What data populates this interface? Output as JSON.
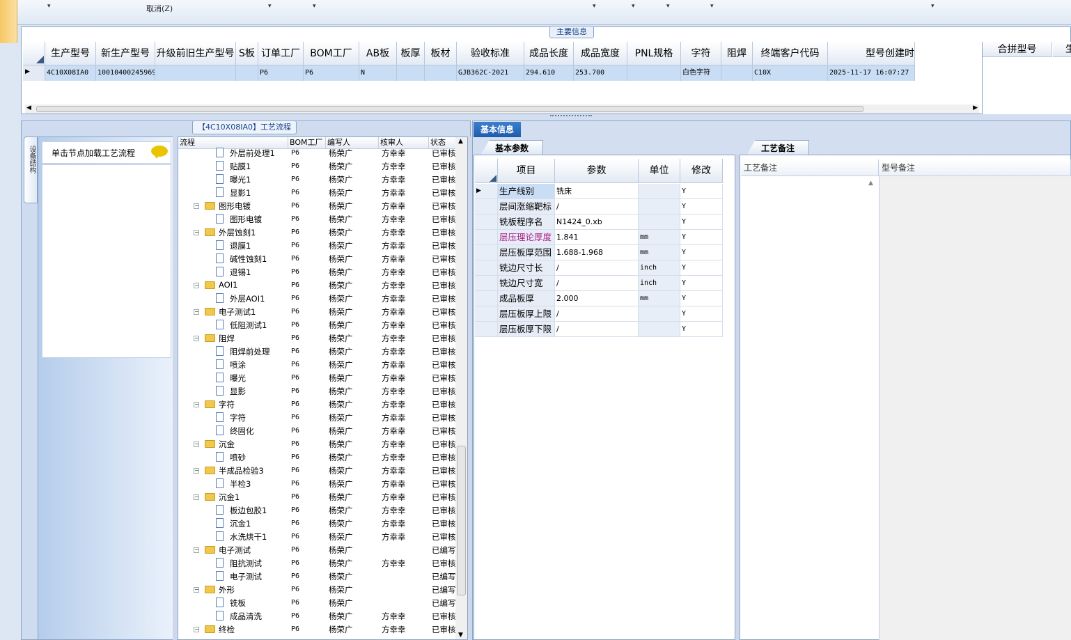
{
  "toolbar": {
    "cancel_label": "取消(Z)"
  },
  "main_info": {
    "caption": "主要信息",
    "columns": [
      "生产型号",
      "新生产型号",
      "升级前旧生产型号",
      "S板",
      "订单工厂",
      "BOM工厂",
      "AB板",
      "板厚",
      "板材",
      "验收标准",
      "成品长度",
      "成品宽度",
      "PNL规格",
      "字符",
      "阻焊",
      "终端客户代码",
      "型号创建时"
    ],
    "row": [
      "4C10X08IA0",
      "10010400245969",
      "",
      "",
      "P6",
      "P6",
      "N",
      "",
      "",
      "GJB362C-2021",
      "294.610",
      "253.700",
      "",
      "白色字符",
      "",
      "C10X",
      "2025-11-17 16:07:27"
    ],
    "side_columns": [
      "合拼型号",
      "生"
    ]
  },
  "process": {
    "caption": "【4C10X08IA0】工艺流程",
    "vertical_tab": "设备结构",
    "load_hint": "单击节点加载工艺流程",
    "columns": [
      "流程",
      "BOM工厂",
      "编写人",
      "核审人",
      "状态"
    ],
    "rows": [
      {
        "level": 2,
        "name": "外层前处理1",
        "bom": "P6",
        "writer": "杨荣广",
        "reviewer": "方幸幸",
        "status": "已审核"
      },
      {
        "level": 2,
        "name": "贴膜1",
        "bom": "P6",
        "writer": "杨荣广",
        "reviewer": "方幸幸",
        "status": "已审核"
      },
      {
        "level": 2,
        "name": "曝光1",
        "bom": "P6",
        "writer": "杨荣广",
        "reviewer": "方幸幸",
        "status": "已审核"
      },
      {
        "level": 2,
        "name": "显影1",
        "bom": "P6",
        "writer": "杨荣广",
        "reviewer": "方幸幸",
        "status": "已审核"
      },
      {
        "level": 1,
        "name": "图形电镀",
        "bom": "P6",
        "writer": "杨荣广",
        "reviewer": "方幸幸",
        "status": "已审核"
      },
      {
        "level": 2,
        "name": "图形电镀",
        "bom": "P6",
        "writer": "杨荣广",
        "reviewer": "方幸幸",
        "status": "已审核"
      },
      {
        "level": 1,
        "name": "外层蚀刻1",
        "bom": "P6",
        "writer": "杨荣广",
        "reviewer": "方幸幸",
        "status": "已审核"
      },
      {
        "level": 2,
        "name": "退膜1",
        "bom": "P6",
        "writer": "杨荣广",
        "reviewer": "方幸幸",
        "status": "已审核"
      },
      {
        "level": 2,
        "name": "碱性蚀刻1",
        "bom": "P6",
        "writer": "杨荣广",
        "reviewer": "方幸幸",
        "status": "已审核"
      },
      {
        "level": 2,
        "name": "退锡1",
        "bom": "P6",
        "writer": "杨荣广",
        "reviewer": "方幸幸",
        "status": "已审核"
      },
      {
        "level": 1,
        "name": "AOI1",
        "bom": "P6",
        "writer": "杨荣广",
        "reviewer": "方幸幸",
        "status": "已审核"
      },
      {
        "level": 2,
        "name": "外层AOI1",
        "bom": "P6",
        "writer": "杨荣广",
        "reviewer": "方幸幸",
        "status": "已审核"
      },
      {
        "level": 1,
        "name": "电子测试1",
        "bom": "P6",
        "writer": "杨荣广",
        "reviewer": "方幸幸",
        "status": "已审核"
      },
      {
        "level": 2,
        "name": "低阻测试1",
        "bom": "P6",
        "writer": "杨荣广",
        "reviewer": "方幸幸",
        "status": "已审核"
      },
      {
        "level": 1,
        "name": "阻焊",
        "bom": "P6",
        "writer": "杨荣广",
        "reviewer": "方幸幸",
        "status": "已审核"
      },
      {
        "level": 2,
        "name": "阻焊前处理",
        "bom": "P6",
        "writer": "杨荣广",
        "reviewer": "方幸幸",
        "status": "已审核"
      },
      {
        "level": 2,
        "name": "喷涂",
        "bom": "P6",
        "writer": "杨荣广",
        "reviewer": "方幸幸",
        "status": "已审核"
      },
      {
        "level": 2,
        "name": "曝光",
        "bom": "P6",
        "writer": "杨荣广",
        "reviewer": "方幸幸",
        "status": "已审核"
      },
      {
        "level": 2,
        "name": "显影",
        "bom": "P6",
        "writer": "杨荣广",
        "reviewer": "方幸幸",
        "status": "已审核"
      },
      {
        "level": 1,
        "name": "字符",
        "bom": "P6",
        "writer": "杨荣广",
        "reviewer": "方幸幸",
        "status": "已审核"
      },
      {
        "level": 2,
        "name": "字符",
        "bom": "P6",
        "writer": "杨荣广",
        "reviewer": "方幸幸",
        "status": "已审核"
      },
      {
        "level": 2,
        "name": "终固化",
        "bom": "P6",
        "writer": "杨荣广",
        "reviewer": "方幸幸",
        "status": "已审核"
      },
      {
        "level": 1,
        "name": "沉金",
        "bom": "P6",
        "writer": "杨荣广",
        "reviewer": "方幸幸",
        "status": "已审核"
      },
      {
        "level": 2,
        "name": "喷砂",
        "bom": "P6",
        "writer": "杨荣广",
        "reviewer": "方幸幸",
        "status": "已审核"
      },
      {
        "level": 1,
        "name": "半成品检验3",
        "bom": "P6",
        "writer": "杨荣广",
        "reviewer": "方幸幸",
        "status": "已审核"
      },
      {
        "level": 2,
        "name": "半检3",
        "bom": "P6",
        "writer": "杨荣广",
        "reviewer": "方幸幸",
        "status": "已审核"
      },
      {
        "level": 1,
        "name": "沉金1",
        "bom": "P6",
        "writer": "杨荣广",
        "reviewer": "方幸幸",
        "status": "已审核"
      },
      {
        "level": 2,
        "name": "板边包胶1",
        "bom": "P6",
        "writer": "杨荣广",
        "reviewer": "方幸幸",
        "status": "已审核"
      },
      {
        "level": 2,
        "name": "沉金1",
        "bom": "P6",
        "writer": "杨荣广",
        "reviewer": "方幸幸",
        "status": "已审核"
      },
      {
        "level": 2,
        "name": "水洗烘干1",
        "bom": "P6",
        "writer": "杨荣广",
        "reviewer": "方幸幸",
        "status": "已审核"
      },
      {
        "level": 1,
        "name": "电子测试",
        "bom": "P6",
        "writer": "杨荣广",
        "reviewer": "",
        "status": "已编写"
      },
      {
        "level": 2,
        "name": "阻抗测试",
        "bom": "P6",
        "writer": "杨荣广",
        "reviewer": "方幸幸",
        "status": "已审核"
      },
      {
        "level": 2,
        "name": "电子测试",
        "bom": "P6",
        "writer": "杨荣广",
        "reviewer": "",
        "status": "已编写"
      },
      {
        "level": 1,
        "name": "外形",
        "bom": "P6",
        "writer": "杨荣广",
        "reviewer": "",
        "status": "已编写"
      },
      {
        "level": 2,
        "name": "铣板",
        "bom": "P6",
        "writer": "杨荣广",
        "reviewer": "",
        "status": "已编写"
      },
      {
        "level": 2,
        "name": "成品清洗",
        "bom": "P6",
        "writer": "杨荣广",
        "reviewer": "方幸幸",
        "status": "已审核"
      },
      {
        "level": 1,
        "name": "终检",
        "bom": "P6",
        "writer": "杨荣广",
        "reviewer": "方幸幸",
        "status": "已审核"
      }
    ]
  },
  "basic_info": {
    "tab": "基本信息",
    "param_tab": "基本参数",
    "columns": [
      "项目",
      "参数",
      "单位",
      "修改"
    ],
    "rows": [
      {
        "item": "生产线别",
        "value": "铣床",
        "unit": "",
        "mod": "Y"
      },
      {
        "item": "层间涨缩靶标",
        "value": "/",
        "unit": "",
        "mod": "Y"
      },
      {
        "item": "铣板程序名",
        "value": "N1424_0.xb",
        "unit": "",
        "mod": "Y"
      },
      {
        "item": "层压理论厚度",
        "value": "1.841",
        "unit": "mm",
        "mod": "Y"
      },
      {
        "item": "层压板厚范围",
        "value": "1.688-1.968",
        "unit": "mm",
        "mod": "Y"
      },
      {
        "item": "铣边尺寸长",
        "value": "/",
        "unit": "inch",
        "mod": "Y"
      },
      {
        "item": "铣边尺寸宽",
        "value": "/",
        "unit": "inch",
        "mod": "Y"
      },
      {
        "item": "成品板厚",
        "value": "2.000",
        "unit": "mm",
        "mod": "Y"
      },
      {
        "item": "层压板厚上限",
        "value": "/",
        "unit": "",
        "mod": "Y"
      },
      {
        "item": "层压板厚下限",
        "value": "/",
        "unit": "",
        "mod": "Y"
      }
    ],
    "highlight_color": "#b0208a",
    "remark_tab": "工艺备注",
    "remark_columns": [
      "工艺备注",
      "型号备注"
    ]
  }
}
